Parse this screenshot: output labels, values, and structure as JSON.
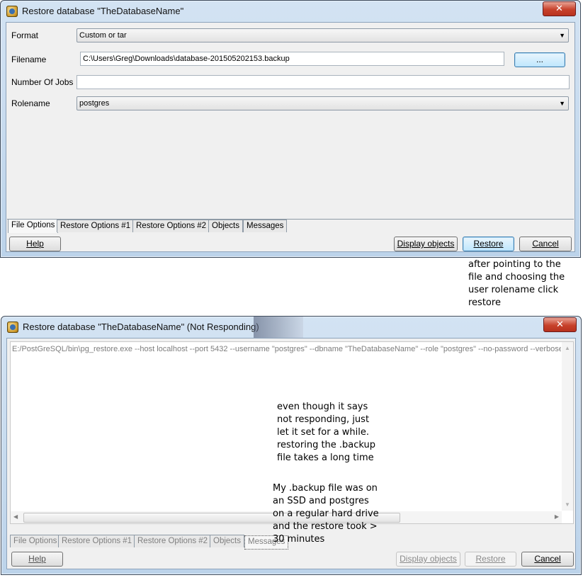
{
  "dialog1": {
    "title": "Restore database \"TheDatabaseName\"",
    "close": "✕",
    "fields": {
      "format_label": "Format",
      "format_value": "Custom or tar",
      "filename_label": "Filename",
      "filename_value": "C:\\Users\\Greg\\Downloads\\database-201505202153.backup",
      "browse_label": "...",
      "jobs_label": "Number Of Jobs",
      "jobs_value": "",
      "rolename_label": "Rolename",
      "rolename_value": "postgres"
    },
    "tabs": [
      "File Options",
      "Restore Options #1",
      "Restore Options #2",
      "Objects",
      "Messages"
    ],
    "buttons": {
      "help": "Help",
      "display_objects": "Display objects",
      "restore": "Restore",
      "cancel": "Cancel"
    }
  },
  "annotation1": "after pointing to the\nfile and choosing the\nuser rolename click\nrestore",
  "dialog2": {
    "title": "Restore database \"TheDatabaseName\" (Not Responding)",
    "close": "✕",
    "log_text": "E:/PostGreSQL/bin\\pg_restore.exe --host localhost --port 5432 --username \"postgres\" --dbname \"TheDatabaseName\" --role \"postgres\" --no-password  --verbose",
    "tabs": [
      "File Options",
      "Restore Options #1",
      "Restore Options #2",
      "Objects",
      "Messages"
    ],
    "buttons": {
      "help": "Help",
      "display_objects": "Display objects",
      "restore": "Restore",
      "cancel": "Cancel"
    }
  },
  "annotation2": "even though it says\nnot responding, just\nlet it set for a while.\nrestoring the .backup\nfile takes a long time",
  "annotation3": "My .backup file was on\nan SSD and postgres\non a regular hard drive\nand the restore took >\n30 minutes"
}
